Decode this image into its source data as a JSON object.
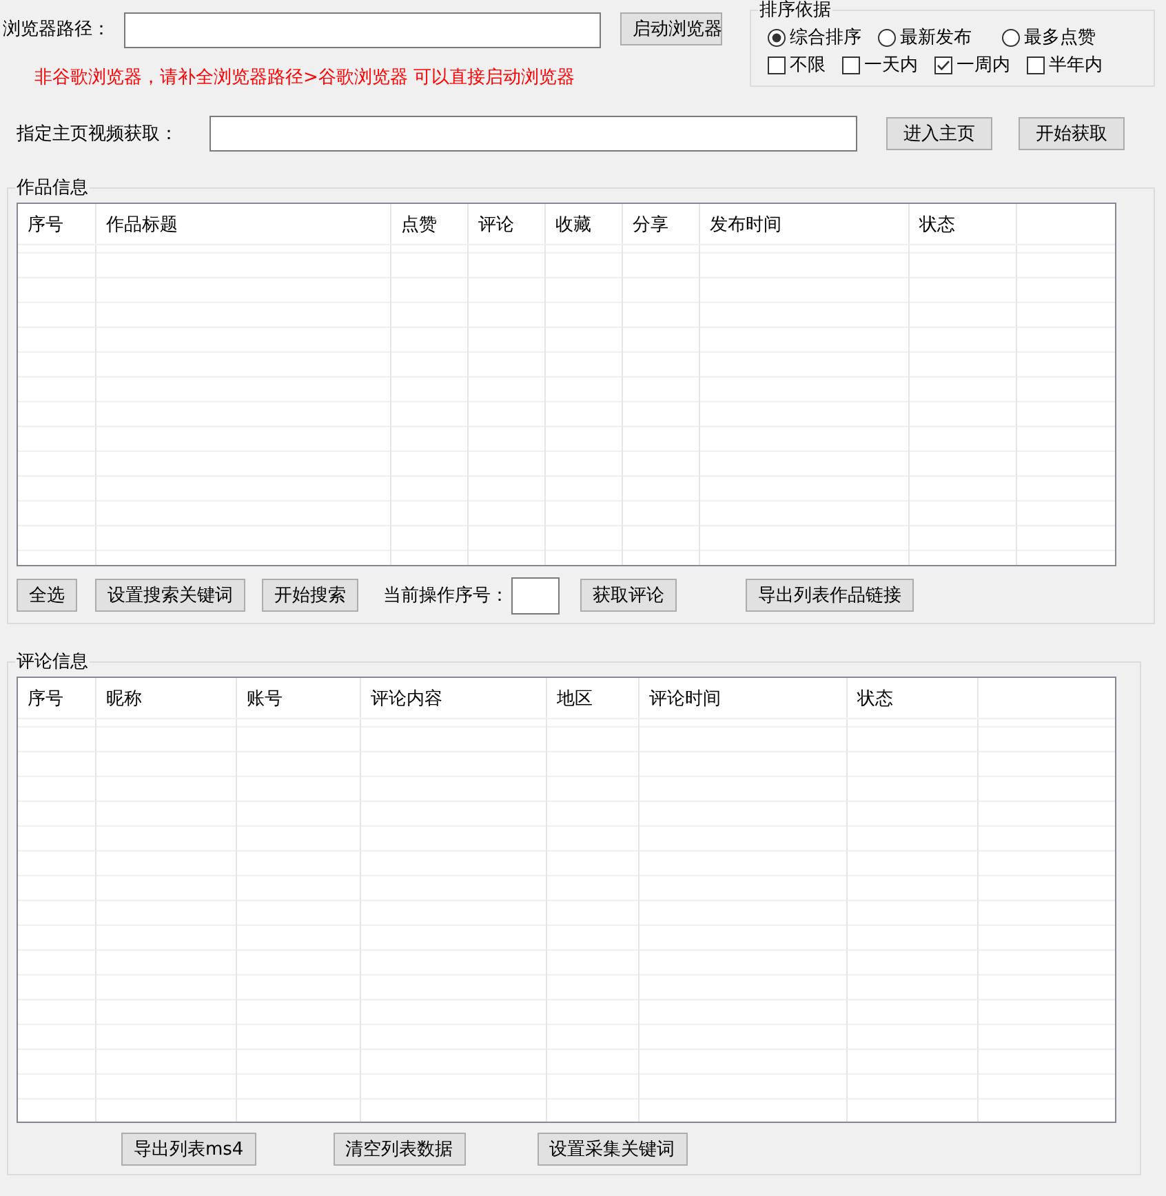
{
  "browser_path": {
    "label": "浏览器路径：",
    "button": "启动浏览器"
  },
  "warning": "非谷歌浏览器，请补全浏览器路径>谷歌浏览器 可以直接启动浏览器",
  "sort_group": {
    "title": "排序依据",
    "sort_options": [
      {
        "label": "综合排序",
        "selected": true
      },
      {
        "label": "最新发布",
        "selected": false
      },
      {
        "label": "最多点赞",
        "selected": false
      }
    ],
    "time_filters": [
      {
        "label": "不限",
        "checked": false
      },
      {
        "label": "一天内",
        "checked": false
      },
      {
        "label": "一周内",
        "checked": true
      },
      {
        "label": "半年内",
        "checked": false
      }
    ]
  },
  "homepage": {
    "label": "指定主页视频获取：",
    "buttons": [
      "进入主页",
      "开始获取"
    ]
  },
  "works": {
    "title": "作品信息",
    "columns": [
      "序号",
      "作品标题",
      "点赞",
      "评论",
      "收藏",
      "分享",
      "发布时间",
      "状态"
    ],
    "toolbar": [
      {
        "kind": "button",
        "label": "全选"
      },
      {
        "kind": "button",
        "label": "设置搜索关键词"
      },
      {
        "kind": "button",
        "label": "开始搜索"
      },
      {
        "kind": "label",
        "label": "当前操作序号："
      },
      {
        "kind": "field"
      },
      {
        "kind": "button",
        "label": "获取评论"
      },
      {
        "kind": "button",
        "label": "导出列表作品链接"
      }
    ]
  },
  "comments": {
    "title": "评论信息",
    "columns": [
      "序号",
      "昵称",
      "账号",
      "评论内容",
      "地区",
      "评论时间",
      "状态"
    ],
    "buttons": [
      "导出列表ms4",
      "清空列表数据",
      "设置采集关键词"
    ]
  }
}
